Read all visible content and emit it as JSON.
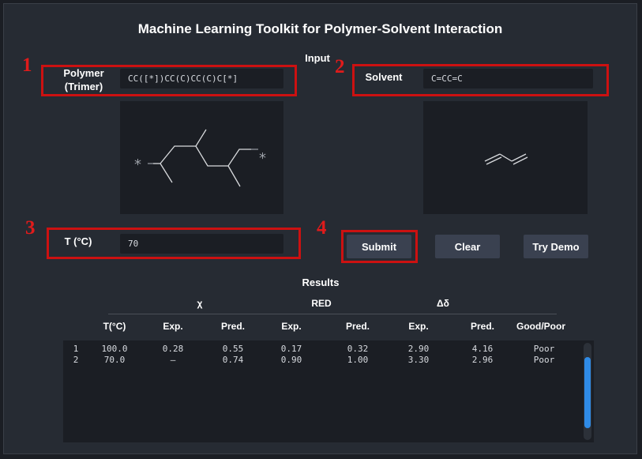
{
  "app_title": "Machine Learning Toolkit for Polymer-Solvent Interaction",
  "input_section_label": "Input",
  "results_section_label": "Results",
  "callouts": [
    "1",
    "2",
    "3",
    "4"
  ],
  "polymer": {
    "label_line1": "Polymer",
    "label_line2": "(Trimer)",
    "value": "CC([*])CC(C)CC(C)C[*]"
  },
  "solvent": {
    "label": "Solvent",
    "value": "C=CC=C"
  },
  "temperature": {
    "label": "T (°C)",
    "value": "70"
  },
  "buttons": {
    "submit": "Submit",
    "clear": "Clear",
    "demo": "Try Demo"
  },
  "structure_labels": {
    "star_left": "*",
    "star_right": "*"
  },
  "table": {
    "groups": [
      "χ",
      "RED",
      "Δδ"
    ],
    "columns": [
      "T(°C)",
      "Exp.",
      "Pred.",
      "Exp.",
      "Pred.",
      "Exp.",
      "Pred.",
      "Good/Poor"
    ],
    "rows": [
      [
        "1",
        "100.0",
        "0.28",
        "0.55",
        "0.17",
        "0.32",
        "2.90",
        "4.16",
        "Poor"
      ],
      [
        "2",
        "70.0",
        "–",
        "0.74",
        "0.90",
        "1.00",
        "3.30",
        "2.96",
        "Poor"
      ]
    ]
  },
  "colors": {
    "accent": "#cc1111",
    "scrollbar": "#2f8be6",
    "button": "#3a4150",
    "background": "#262b33"
  }
}
